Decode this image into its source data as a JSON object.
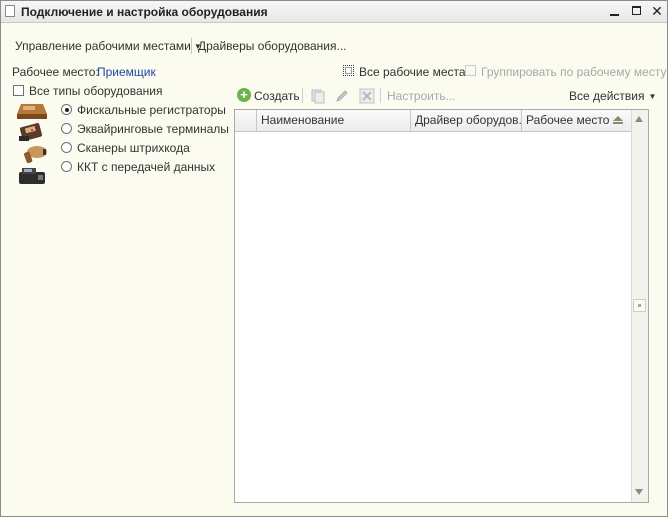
{
  "window": {
    "title": "Подключение и настройка оборудования",
    "controls": [
      "minimize",
      "maximize",
      "close"
    ]
  },
  "toolbar": {
    "manage_workplaces": "Управление рабочими местами",
    "equipment_drivers": "Драйверы оборудования..."
  },
  "workplace": {
    "label": "Рабочее место:",
    "value": "Приемщик"
  },
  "filters": {
    "all_workplaces": {
      "label": "Все рабочие места",
      "checked": false
    },
    "group_by_workplace": {
      "label": "Группировать по рабочему месту",
      "checked": false,
      "disabled": true
    },
    "all_equipment_types": {
      "label": "Все типы оборудования",
      "checked": false
    }
  },
  "equipment_types": [
    {
      "label": "Фискальные регистраторы",
      "selected": true,
      "icon": "fiscal-registrar-icon"
    },
    {
      "label": "Эквайринговые терминалы",
      "selected": false,
      "icon": "acquiring-terminal-icon"
    },
    {
      "label": "Сканеры штрихкода",
      "selected": false,
      "icon": "barcode-scanner-icon"
    },
    {
      "label": "ККТ с передачей данных",
      "selected": false,
      "icon": "cash-register-icon"
    }
  ],
  "table_toolbar": {
    "create": "Создать",
    "configure": "Настроить...",
    "all_actions": "Все действия"
  },
  "grid": {
    "columns": [
      "Наименование",
      "Драйвер оборудов...",
      "Рабочее место"
    ],
    "rows": []
  },
  "colors": {
    "background": "#FBFBF0",
    "link": "#1E4BA0",
    "create_accent": "#6BB34A"
  }
}
